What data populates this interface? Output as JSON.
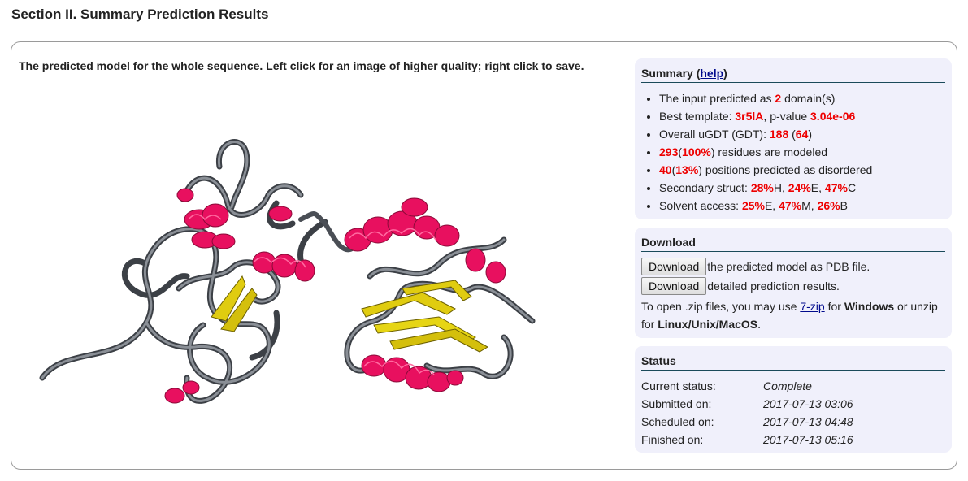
{
  "section_title": "Section II. Summary Prediction Results",
  "caption": "The predicted model for the whole sequence. Left click for an image of higher quality; right click to save.",
  "summary": {
    "heading": "Summary (",
    "help_label": "help",
    "heading_close": ")",
    "items": [
      {
        "t1": "The input predicted as ",
        "v1": "2",
        "t2": " domain(s)"
      },
      {
        "t1": "Best template: ",
        "v1": "3r5lA",
        "t2": ", p-value ",
        "v2": "3.04e-06"
      },
      {
        "t1": "Overall uGDT (GDT): ",
        "v1": "188",
        "t2": " (",
        "v2": "64",
        "t3": ")"
      },
      {
        "v1": "293",
        "t1": "(",
        "v2": "100%",
        "t2": ") residues are modeled"
      },
      {
        "v1": "40",
        "t1": "(",
        "v2": "13%",
        "t2": ") positions predicted as disordered"
      },
      {
        "t1": "Secondary struct: ",
        "v1": "28%",
        "t2": "H, ",
        "v2": "24%",
        "t3": "E, ",
        "v3": "47%",
        "t4": "C"
      },
      {
        "t1": "Solvent access: ",
        "v1": "25%",
        "t2": "E, ",
        "v2": "47%",
        "t3": "M, ",
        "v3": "26%",
        "t4": "B"
      }
    ]
  },
  "download": {
    "heading": "Download",
    "button_label": "Download",
    "pdb_text": "the predicted model as PDB file.",
    "detail_text": "detailed prediction results.",
    "note_pre": "To open .zip files, you may use ",
    "zip_link": "7-zip",
    "note_mid1": " for ",
    "windows": "Windows",
    "note_mid2": " or unzip for ",
    "linux": "Linux/Unix/MacOS",
    "note_end": "."
  },
  "status": {
    "heading": "Status",
    "rows": [
      {
        "label": "Current status:",
        "value": "Complete"
      },
      {
        "label": "Submitted on:",
        "value": "2017-07-13 03:06"
      },
      {
        "label": "Scheduled on:",
        "value": "2017-07-13 04:48"
      },
      {
        "label": "Finished on:",
        "value": "2017-07-13 05:16"
      }
    ]
  },
  "colors": {
    "helix": "#e8105f",
    "strand": "#e0cc10",
    "coil": "#5c6066",
    "highlight": "#ee0000",
    "panel_bg": "#f0f0fb"
  }
}
